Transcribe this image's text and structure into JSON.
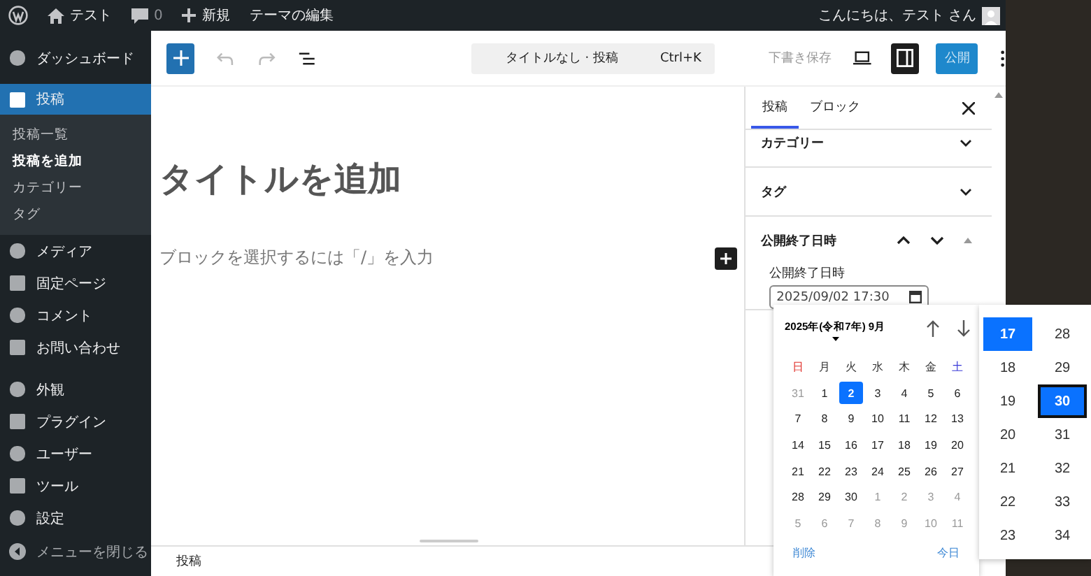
{
  "admin_bar": {
    "site": "テスト",
    "comments": "0",
    "new": "新規",
    "theme_edit": "テーマの編集",
    "greeting": "こんにちは、テスト さん"
  },
  "sidebar": {
    "groups": [
      {
        "items": [
          {
            "label": "ダッシュボード",
            "selected": false
          },
          {
            "label": "投稿",
            "selected": true,
            "children": [
              {
                "label": "投稿一覧",
                "selected": false
              },
              {
                "label": "投稿を追加",
                "selected": true
              },
              {
                "label": "カテゴリー",
                "selected": false
              },
              {
                "label": "タグ",
                "selected": false
              }
            ]
          },
          {
            "label": "メディア",
            "selected": false
          },
          {
            "label": "固定ページ",
            "selected": false
          },
          {
            "label": "コメント",
            "selected": false
          },
          {
            "label": "お問い合わせ",
            "selected": false
          }
        ]
      },
      {
        "items": [
          {
            "label": "外観",
            "selected": false
          },
          {
            "label": "プラグイン",
            "selected": false
          },
          {
            "label": "ユーザー",
            "selected": false
          },
          {
            "label": "ツール",
            "selected": false
          },
          {
            "label": "設定",
            "selected": false
          }
        ]
      }
    ],
    "collapse": "メニューを閉じる"
  },
  "editor_header": {
    "document_title": "タイトルなし · 投稿",
    "shortcut": "Ctrl+K",
    "save_draft": "下書き保存",
    "publish": "公開",
    "settings_open": true
  },
  "canvas": {
    "title_placeholder": "タイトルを追加",
    "block_placeholder": "ブロックを選択するには「/」を入力"
  },
  "panel": {
    "tabs": [
      {
        "label": "投稿",
        "selected": true
      },
      {
        "label": "ブロック",
        "selected": false
      }
    ],
    "sections": [
      {
        "title": "カテゴリー",
        "expanded": false
      },
      {
        "title": "タグ",
        "expanded": false
      },
      {
        "title": "公開終了日時",
        "expanded": true,
        "field_label": "公開終了日時",
        "value": "2025/09/02 17:30"
      }
    ]
  },
  "date_picker": {
    "month": "2025年(令和7年) 9月",
    "weekdays": [
      {
        "label": "日",
        "color": "#e0302a"
      },
      {
        "label": "月",
        "color": "#333333"
      },
      {
        "label": "火",
        "color": "#333333"
      },
      {
        "label": "水",
        "color": "#333333"
      },
      {
        "label": "木",
        "color": "#333333"
      },
      {
        "label": "金",
        "color": "#333333"
      },
      {
        "label": "土",
        "color": "#3b3bd8"
      }
    ],
    "days": [
      {
        "label": "31",
        "outside": true,
        "selected": false
      },
      {
        "label": "1",
        "outside": false,
        "selected": false
      },
      {
        "label": "2",
        "outside": false,
        "selected": true
      },
      {
        "label": "3",
        "outside": false,
        "selected": false
      },
      {
        "label": "4",
        "outside": false,
        "selected": false
      },
      {
        "label": "5",
        "outside": false,
        "selected": false
      },
      {
        "label": "6",
        "outside": false,
        "selected": false
      },
      {
        "label": "7",
        "outside": false,
        "selected": false
      },
      {
        "label": "8",
        "outside": false,
        "selected": false
      },
      {
        "label": "9",
        "outside": false,
        "selected": false
      },
      {
        "label": "10",
        "outside": false,
        "selected": false
      },
      {
        "label": "11",
        "outside": false,
        "selected": false
      },
      {
        "label": "12",
        "outside": false,
        "selected": false
      },
      {
        "label": "13",
        "outside": false,
        "selected": false
      },
      {
        "label": "14",
        "outside": false,
        "selected": false
      },
      {
        "label": "15",
        "outside": false,
        "selected": false
      },
      {
        "label": "16",
        "outside": false,
        "selected": false
      },
      {
        "label": "17",
        "outside": false,
        "selected": false
      },
      {
        "label": "18",
        "outside": false,
        "selected": false
      },
      {
        "label": "19",
        "outside": false,
        "selected": false
      },
      {
        "label": "20",
        "outside": false,
        "selected": false
      },
      {
        "label": "21",
        "outside": false,
        "selected": false
      },
      {
        "label": "22",
        "outside": false,
        "selected": false
      },
      {
        "label": "23",
        "outside": false,
        "selected": false
      },
      {
        "label": "24",
        "outside": false,
        "selected": false
      },
      {
        "label": "25",
        "outside": false,
        "selected": false
      },
      {
        "label": "26",
        "outside": false,
        "selected": false
      },
      {
        "label": "27",
        "outside": false,
        "selected": false
      },
      {
        "label": "28",
        "outside": false,
        "selected": false
      },
      {
        "label": "29",
        "outside": false,
        "selected": false
      },
      {
        "label": "30",
        "outside": false,
        "selected": false
      },
      {
        "label": "1",
        "outside": true,
        "selected": false
      },
      {
        "label": "2",
        "outside": true,
        "selected": false
      },
      {
        "label": "3",
        "outside": true,
        "selected": false
      },
      {
        "label": "4",
        "outside": true,
        "selected": false
      },
      {
        "label": "5",
        "outside": true,
        "selected": false
      },
      {
        "label": "6",
        "outside": true,
        "selected": false
      },
      {
        "label": "7",
        "outside": true,
        "selected": false
      },
      {
        "label": "8",
        "outside": true,
        "selected": false
      },
      {
        "label": "9",
        "outside": true,
        "selected": false
      },
      {
        "label": "10",
        "outside": true,
        "selected": false
      },
      {
        "label": "11",
        "outside": true,
        "selected": false
      }
    ],
    "clear": "削除",
    "today": "今日",
    "hours": [
      {
        "label": "17",
        "selected": true
      },
      {
        "label": "18",
        "selected": false
      },
      {
        "label": "19",
        "selected": false
      },
      {
        "label": "20",
        "selected": false
      },
      {
        "label": "21",
        "selected": false
      },
      {
        "label": "22",
        "selected": false
      },
      {
        "label": "23",
        "selected": false
      }
    ],
    "minutes": [
      {
        "label": "28",
        "selected": false
      },
      {
        "label": "29",
        "selected": false
      },
      {
        "label": "30",
        "selected": true
      },
      {
        "label": "31",
        "selected": false
      },
      {
        "label": "32",
        "selected": false
      },
      {
        "label": "33",
        "selected": false
      },
      {
        "label": "34",
        "selected": false
      }
    ]
  },
  "footer": {
    "breadcrumb": "投稿"
  }
}
